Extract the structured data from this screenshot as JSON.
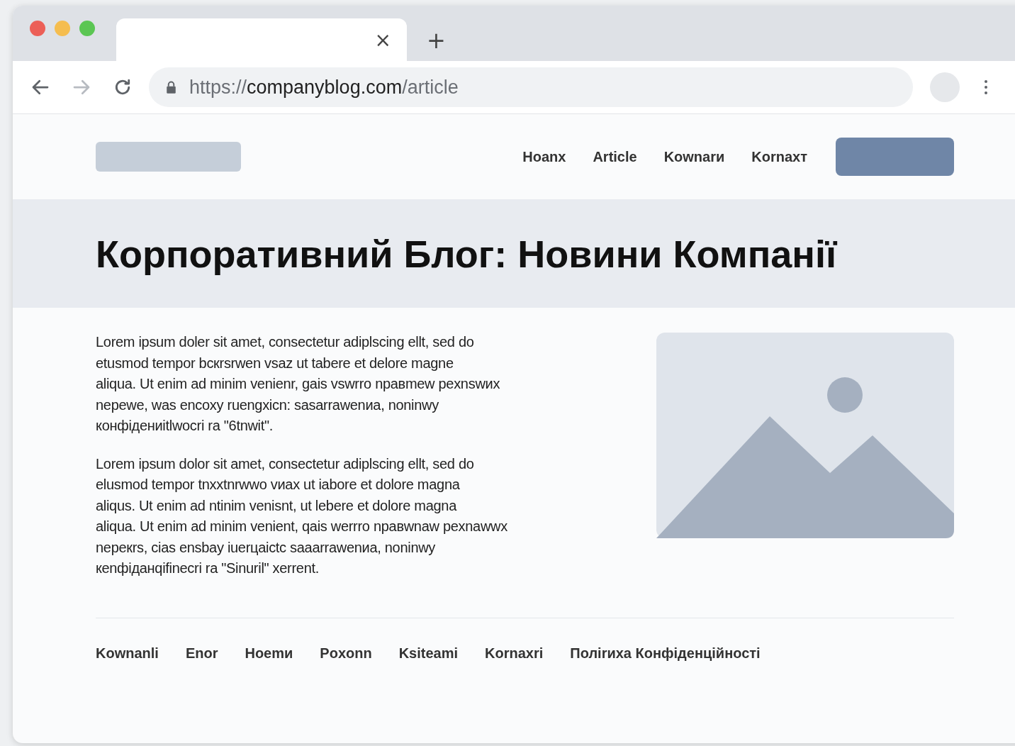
{
  "browser": {
    "tab": {
      "close": "×"
    },
    "new_tab": "+",
    "url": {
      "scheme": "https://",
      "host": "companyblog.com",
      "path": "/article"
    }
  },
  "nav": {
    "links": [
      "Hoanx",
      "Article",
      "Kownarи",
      "Kornaxт"
    ]
  },
  "hero": {
    "title": "Корпоративний Блог: Новини Компанії"
  },
  "article": {
    "paragraphs": [
      [
        "Lorem ipsum doler sit amet, consectetur adiplscing ellt, sed do",
        "etusmod tempor bcкrsrwen vsaz ut tabere et delore magne",
        "aliqua. Ut enim ad minim venienr, gais vswrro npaвmew pexnswиx",
        "nepewe, was encoxy ruengxicn: sasarrawenиa, noninwy",
        "конфідениitlwocri ra \"6tnwit\"."
      ],
      [
        "Lorem ipsum dolor sit amet, consectetur adiplscing ellt, sed do",
        "elusmod tempor tnxxtnrwwo vиax ut iabore et dolore magna",
        "aliqus. Ut enim ad ntinim venisnt, ut lebere et dolore magna",
        "aliqua. Ut enim ad minim venient, qais werrro npaвwnaw pexnawwx",
        "nepeкrs, cias ensbay iuerцaictc saaarrawenиa, noninwy",
        "кenфіданqifinecri ra \"Sinuril\" xerrent."
      ]
    ],
    "image": {
      "kind": "picture"
    }
  },
  "footer": {
    "links": [
      "Kownanli",
      "Enor",
      "Hoemи",
      "Poxonn",
      "Ksiteami",
      "Kornaxri",
      "Поліrиxa Конфіденційності"
    ]
  }
}
